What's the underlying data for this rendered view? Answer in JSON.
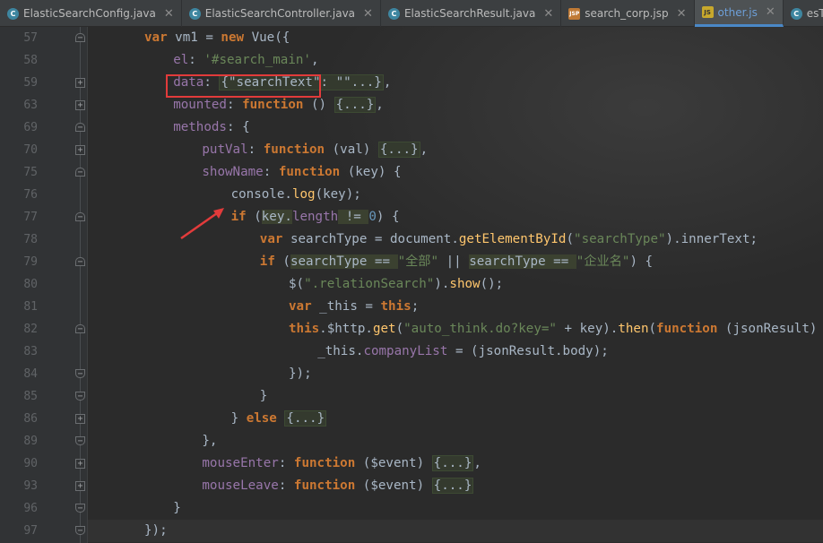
{
  "tabs": [
    {
      "label": "ElasticSearchConfig.java",
      "type": "java",
      "icon": "C"
    },
    {
      "label": "ElasticSearchController.java",
      "type": "java",
      "icon": "C"
    },
    {
      "label": "ElasticSearchResult.java",
      "type": "java",
      "icon": "C"
    },
    {
      "label": "search_corp.jsp",
      "type": "jsp",
      "icon": "JSP"
    },
    {
      "label": "other.js",
      "type": "js",
      "icon": "JS",
      "active": true
    },
    {
      "label": "esTest.java",
      "type": "java",
      "icon": "C"
    }
  ],
  "lines": [
    {
      "num": "57",
      "fold": "start",
      "indent": 0,
      "tokens": [
        [
          "kw",
          "var "
        ],
        [
          "plain",
          "vm1 = "
        ],
        [
          "kw",
          "new "
        ],
        [
          "plain",
          "Vue({"
        ]
      ]
    },
    {
      "num": "58",
      "fold": "",
      "indent": 1,
      "tokens": [
        [
          "prop",
          "el"
        ],
        [
          "plain",
          ": "
        ],
        [
          "str",
          "'#search_main'"
        ],
        [
          "plain",
          ","
        ]
      ]
    },
    {
      "num": "59",
      "fold": "plus",
      "indent": 1,
      "tokens": [
        [
          "prop",
          "data"
        ],
        [
          "plain",
          ": "
        ],
        [
          "box",
          "{\"searchText\": \"\"...}"
        ],
        [
          "plain",
          ","
        ]
      ]
    },
    {
      "num": "63",
      "fold": "plus",
      "indent": 1,
      "tokens": [
        [
          "prop",
          "mounted"
        ],
        [
          "plain",
          ": "
        ],
        [
          "kw",
          "function "
        ],
        [
          "plain",
          "() "
        ],
        [
          "box",
          "{...}"
        ],
        [
          "plain",
          ","
        ]
      ]
    },
    {
      "num": "69",
      "fold": "start",
      "indent": 1,
      "tokens": [
        [
          "prop",
          "methods"
        ],
        [
          "plain",
          ": {"
        ]
      ]
    },
    {
      "num": "70",
      "fold": "plus",
      "indent": 2,
      "tokens": [
        [
          "prop",
          "putVal"
        ],
        [
          "plain",
          ": "
        ],
        [
          "kw",
          "function "
        ],
        [
          "plain",
          "(val) "
        ],
        [
          "box",
          "{...}"
        ],
        [
          "plain",
          ","
        ]
      ]
    },
    {
      "num": "75",
      "fold": "start",
      "indent": 2,
      "tokens": [
        [
          "prop",
          "showName"
        ],
        [
          "plain",
          ": "
        ],
        [
          "kw",
          "function "
        ],
        [
          "plain",
          "(key) {"
        ]
      ]
    },
    {
      "num": "76",
      "fold": "",
      "indent": 3,
      "tokens": [
        [
          "plain",
          "console."
        ],
        [
          "fn",
          "log"
        ],
        [
          "plain",
          "(key);"
        ]
      ]
    },
    {
      "num": "77",
      "fold": "start",
      "indent": 3,
      "tokens": [
        [
          "kw",
          "if "
        ],
        [
          "plain",
          "("
        ],
        [
          "hl",
          "key."
        ],
        [
          "prop",
          "length"
        ],
        [
          "hl",
          " != "
        ],
        [
          "num",
          "0"
        ],
        [
          "plain",
          ") {"
        ]
      ]
    },
    {
      "num": "78",
      "fold": "",
      "indent": 4,
      "tokens": [
        [
          "kw",
          "var "
        ],
        [
          "plain",
          "searchType = document."
        ],
        [
          "fn",
          "getElementById"
        ],
        [
          "plain",
          "("
        ],
        [
          "str",
          "\"searchType\""
        ],
        [
          "plain",
          ").innerText;"
        ]
      ]
    },
    {
      "num": "79",
      "fold": "start",
      "indent": 4,
      "tokens": [
        [
          "kw",
          "if "
        ],
        [
          "plain",
          "("
        ],
        [
          "hl",
          "searchType == "
        ],
        [
          "str",
          "\"全部\""
        ],
        [
          "plain",
          " || "
        ],
        [
          "hl",
          "searchType == "
        ],
        [
          "str",
          "\"企业名\""
        ],
        [
          "plain",
          ") {"
        ]
      ]
    },
    {
      "num": "80",
      "fold": "",
      "indent": 5,
      "tokens": [
        [
          "plain",
          "$("
        ],
        [
          "str",
          "\".relationSearch\""
        ],
        [
          "plain",
          ")."
        ],
        [
          "fn",
          "show"
        ],
        [
          "plain",
          "();"
        ]
      ]
    },
    {
      "num": "81",
      "fold": "",
      "indent": 5,
      "tokens": [
        [
          "kw",
          "var "
        ],
        [
          "plain",
          "_this = "
        ],
        [
          "kw",
          "this"
        ],
        [
          "plain",
          ";"
        ]
      ]
    },
    {
      "num": "82",
      "fold": "start",
      "indent": 5,
      "tokens": [
        [
          "kw",
          "this"
        ],
        [
          "plain",
          ".$http."
        ],
        [
          "fn",
          "get"
        ],
        [
          "plain",
          "("
        ],
        [
          "str",
          "\"auto_think.do?key=\""
        ],
        [
          "plain",
          " + key)."
        ],
        [
          "fn",
          "then"
        ],
        [
          "plain",
          "("
        ],
        [
          "kw",
          "function "
        ],
        [
          "plain",
          "(jsonResult) {"
        ]
      ]
    },
    {
      "num": "83",
      "fold": "",
      "indent": 6,
      "tokens": [
        [
          "plain",
          "_this."
        ],
        [
          "prop",
          "companyList"
        ],
        [
          "plain",
          " = (jsonResult.body);"
        ]
      ]
    },
    {
      "num": "84",
      "fold": "end",
      "indent": 5,
      "tokens": [
        [
          "plain",
          "});"
        ]
      ]
    },
    {
      "num": "85",
      "fold": "end",
      "indent": 4,
      "tokens": [
        [
          "plain",
          "}"
        ]
      ]
    },
    {
      "num": "86",
      "fold": "plus",
      "indent": 3,
      "tokens": [
        [
          "plain",
          "} "
        ],
        [
          "kw",
          "else "
        ],
        [
          "box",
          "{...}"
        ]
      ]
    },
    {
      "num": "89",
      "fold": "end",
      "indent": 2,
      "tokens": [
        [
          "plain",
          "},"
        ]
      ]
    },
    {
      "num": "90",
      "fold": "plus",
      "indent": 2,
      "tokens": [
        [
          "prop",
          "mouseEnter"
        ],
        [
          "plain",
          ": "
        ],
        [
          "kw",
          "function "
        ],
        [
          "plain",
          "($event) "
        ],
        [
          "box",
          "{...}"
        ],
        [
          "plain",
          ","
        ]
      ]
    },
    {
      "num": "93",
      "fold": "plus",
      "indent": 2,
      "tokens": [
        [
          "prop",
          "mouseLeave"
        ],
        [
          "plain",
          ": "
        ],
        [
          "kw",
          "function "
        ],
        [
          "plain",
          "($event) "
        ],
        [
          "box",
          "{...}"
        ]
      ]
    },
    {
      "num": "96",
      "fold": "end",
      "indent": 1,
      "tokens": [
        [
          "plain",
          "}"
        ]
      ]
    },
    {
      "num": "97",
      "fold": "end",
      "indent": 0,
      "tokens": [
        [
          "plain",
          "});"
        ]
      ]
    }
  ]
}
